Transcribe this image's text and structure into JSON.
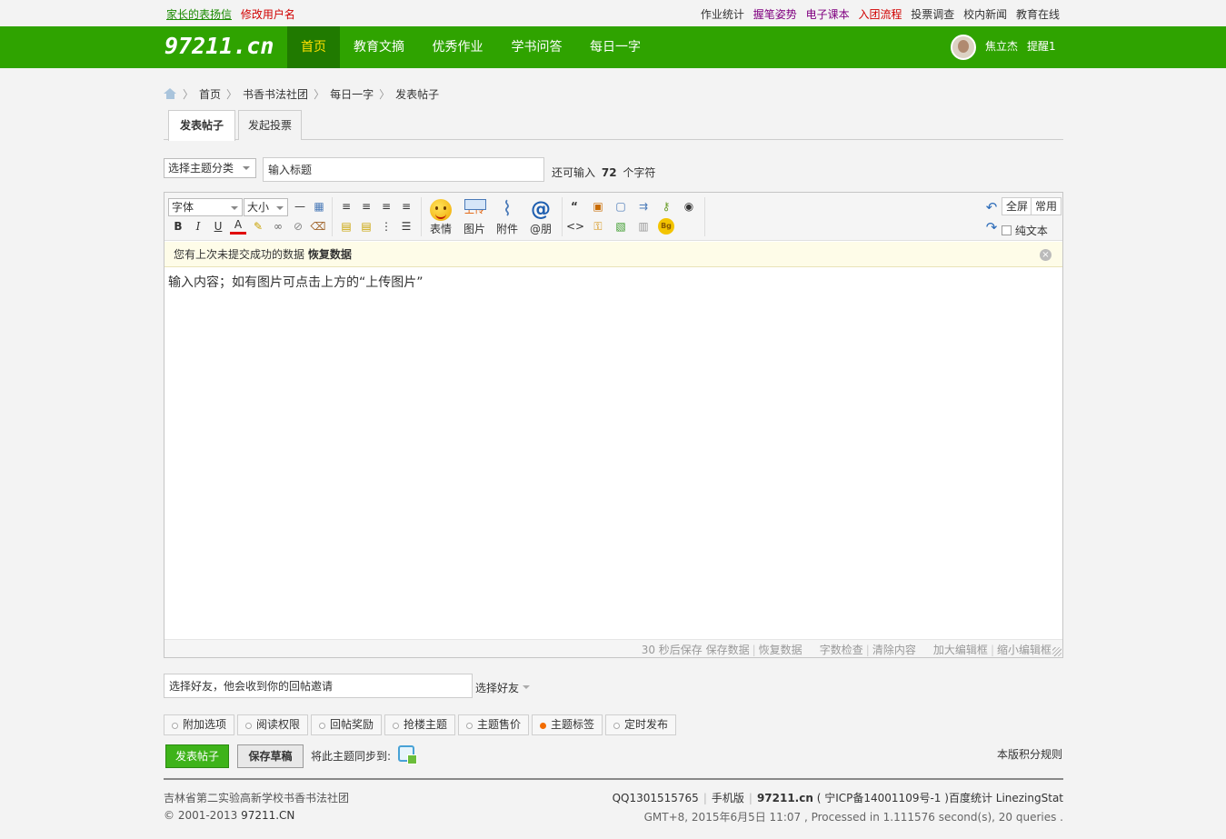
{
  "topbar": {
    "left_links": [
      {
        "label": "家长的表扬信",
        "color": "#1a8a00",
        "underline": true
      },
      {
        "label": "修改用户名",
        "color": "#d10000",
        "underline": false
      }
    ],
    "right_links": [
      {
        "label": "作业统计",
        "color": "#333333"
      },
      {
        "label": "握笔姿势",
        "color": "#800080"
      },
      {
        "label": "电子课本",
        "color": "#800080"
      },
      {
        "label": "入团流程",
        "color": "#d10000"
      },
      {
        "label": "投票调查",
        "color": "#333333"
      },
      {
        "label": "校内新闻",
        "color": "#333333"
      },
      {
        "label": "教育在线",
        "color": "#333333"
      }
    ]
  },
  "nav": {
    "logo": "97211.cn",
    "items": [
      "首页",
      "教育文摘",
      "优秀作业",
      "学书问答",
      "每日一字"
    ],
    "active_index": 0,
    "user_name": "焦立杰",
    "remind": "提醒1"
  },
  "breadcrumb": [
    "首页",
    "书香书法社团",
    "每日一字",
    "发表帖子"
  ],
  "tabs": [
    "发表帖子",
    "发起投票"
  ],
  "subject": {
    "type_select": "选择主题分类",
    "title_value": "输入标题",
    "remain_prefix": "还可输入",
    "remain_count": "72",
    "remain_suffix": "个字符"
  },
  "toolbar": {
    "font_select": "字体",
    "size_select": "大小",
    "bold": "B",
    "italic": "I",
    "underline": "U",
    "font_color": "A",
    "big_buttons": [
      "表情",
      "图片",
      "附件",
      "@朋"
    ],
    "upload_text": "上传",
    "fullscreen": "全屏",
    "common": "常用",
    "plain_text": "纯文本"
  },
  "notice": {
    "text": "您有上次未提交成功的数据",
    "action": "恢复数据"
  },
  "editor_content": "输入内容；如有图片可点击上方的“上传图片”",
  "statusbar": {
    "items": [
      "30 秒后保存",
      "保存数据",
      "恢复数据",
      "字数检查",
      "清除内容",
      "加大编辑框",
      "缩小编辑框"
    ]
  },
  "friend": {
    "input_value": "选择好友，他会收到你的回帖邀请",
    "select_label": "选择好友"
  },
  "options": [
    "附加选项",
    "阅读权限",
    "回帖奖励",
    "抢楼主题",
    "主题售价",
    "主题标签",
    "定时发布"
  ],
  "actions": {
    "post": "发表帖子",
    "draft": "保存草稿",
    "sync": "将此主题同步到:",
    "rules": "本版积分规则"
  },
  "footer": {
    "school": "吉林省第二实验高新学校书香书法社团",
    "copyright": "© 2001-2013",
    "copyright_site": "97211.CN",
    "qq": "QQ1301515765",
    "mobile": "手机版",
    "site": "97211.cn",
    "icp": "( 宁ICP备14001109号-1 )",
    "stat": "百度统计 LinezingStat",
    "gmt": "GMT+8, 2015年6月5日 11:07 , Processed in 1.111576 second(s), 20 queries ."
  },
  "colors": {
    "nav_green": "#2fa300",
    "nav_active": "#207a00",
    "active_text": "#ffe000",
    "post_button": "#3eb31a"
  }
}
